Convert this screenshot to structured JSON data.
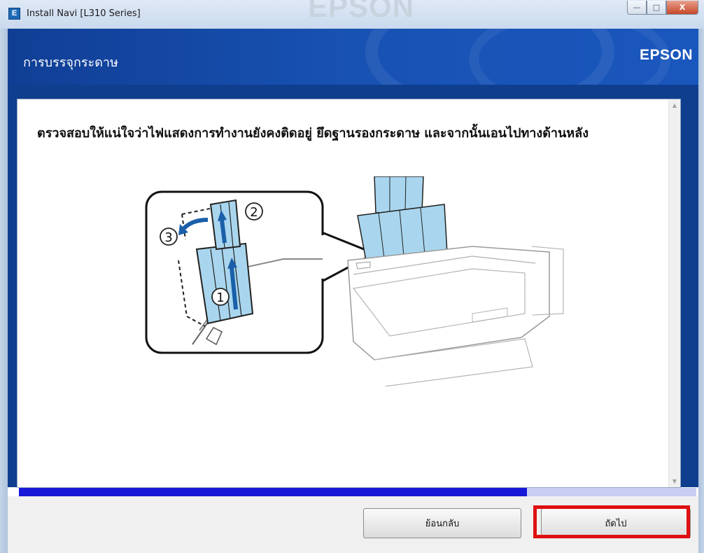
{
  "window": {
    "title": "Install Navi [L310 Series]",
    "app_icon_letter": "E",
    "watermark": "EPSON",
    "controls": {
      "minimize": "—",
      "maximize": "□",
      "close": "X"
    }
  },
  "header": {
    "title": "การบรรจุกระดาษ",
    "brand": "EPSON"
  },
  "content": {
    "instruction": "ตรวจสอบให้แน่ใจว่าไฟแสดงการทำงานยังคงติดอยู่ ยึดฐานรองกระดาษ และจากนั้นเอนไปทางด้านหลัง",
    "step_labels": [
      "1",
      "2",
      "3"
    ]
  },
  "progress": {
    "value": 0.75
  },
  "footer": {
    "back_label": "ย้อนกลับ",
    "next_label": "ถัดไป"
  },
  "colors": {
    "header_blue": "#1852b3",
    "progress_fill": "#1818d8",
    "progress_track": "#c9cdf3",
    "highlight": "#e01010",
    "paper_support": "#a9d6ee"
  }
}
